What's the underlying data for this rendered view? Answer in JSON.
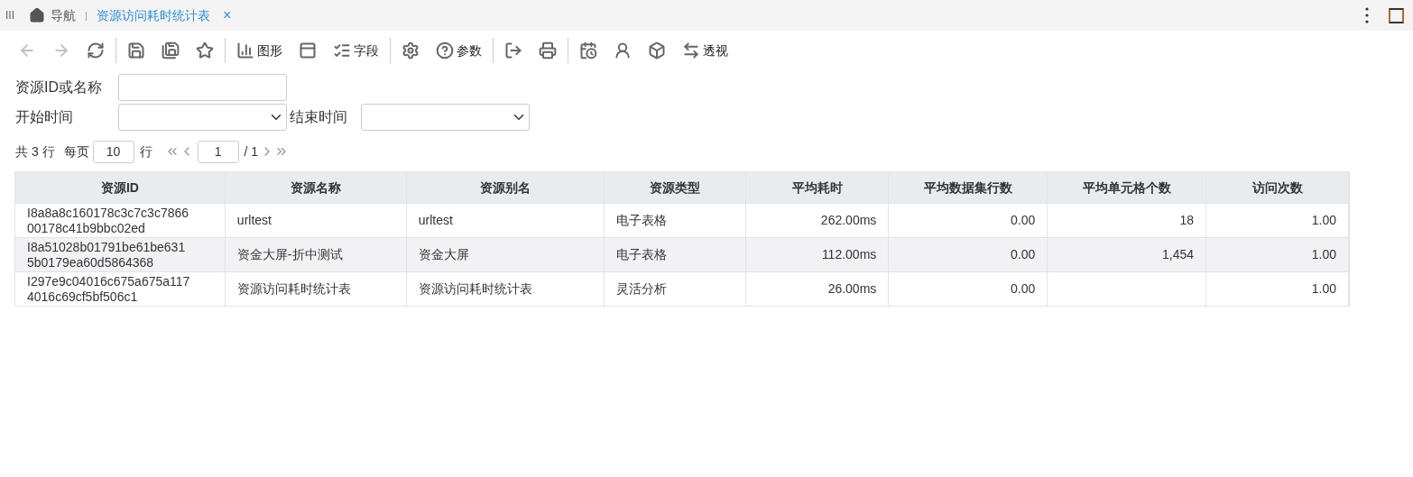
{
  "tab_bar": {
    "menu_icon": "III",
    "home": {
      "label": "导航"
    },
    "separator": "|",
    "tabs": [
      {
        "label": "资源访问耗时统计表",
        "selected": true,
        "close": "×"
      }
    ]
  },
  "toolbar": {
    "groups": [
      [
        {
          "disabled": true
        },
        {
          "disabled": true
        },
        {
          "disabled": false
        }
      ],
      [
        {
          "disabled": false
        },
        {
          "disabled": false
        },
        {
          "disabled": false
        }
      ],
      [
        {
          "label": "图形",
          "disabled": false
        },
        {
          "disabled": false
        },
        {
          "label": "字段",
          "disabled": false
        }
      ],
      [
        {
          "disabled": false
        },
        {
          "label": "参数",
          "disabled": false
        }
      ],
      [
        {
          "disabled": false
        },
        {
          "disabled": false
        }
      ],
      [
        {
          "disabled": false
        },
        {
          "disabled": false
        },
        {
          "disabled": false
        },
        {
          "label": "透视",
          "disabled": false
        }
      ]
    ]
  },
  "filters": {
    "name_label": "资源ID或名称",
    "start_label": "开始时间",
    "end_label": "结束时间"
  },
  "pager": {
    "total": "共 3 行",
    "per_page_label": "每页",
    "per_page": "10",
    "rows_unit": "行",
    "page": "1",
    "page_count": "/ 1"
  },
  "table": {
    "columns": [
      {
        "label": "资源ID",
        "kind": "text"
      },
      {
        "label": "资源名称",
        "kind": "text"
      },
      {
        "label": "资源别名",
        "kind": "text"
      },
      {
        "label": "资源类型",
        "kind": "text"
      },
      {
        "label": "平均耗时",
        "kind": "number"
      },
      {
        "label": "平均数据集行数",
        "kind": "number"
      },
      {
        "label": "平均单元格个数",
        "kind": "number"
      },
      {
        "label": "访问次数",
        "kind": "number"
      }
    ],
    "rows": [
      {
        "selected": false,
        "cells": [
          "I8a8a8c160178c3c7c3c7866 00178c41b9bbc02ed",
          "urltest",
          "urltest",
          "电子表格",
          "262.00ms",
          "0.00",
          "18",
          "1.00"
        ]
      },
      {
        "selected": true,
        "cells": [
          "I8a51028b01791be61be631 5b0179ea60d5864368",
          "资金大屏-折中测试",
          "资金大屏",
          "电子表格",
          "112.00ms",
          "0.00",
          "1,454",
          "1.00"
        ]
      },
      {
        "selected": false,
        "cells": [
          "I297e9c04016c675a675a117 4016c69cf5bf506c1",
          "资源访问耗时统计表",
          "资源访问耗时统计表",
          "灵活分析",
          "26.00ms",
          "0.00",
          "",
          "1.00"
        ]
      }
    ]
  }
}
